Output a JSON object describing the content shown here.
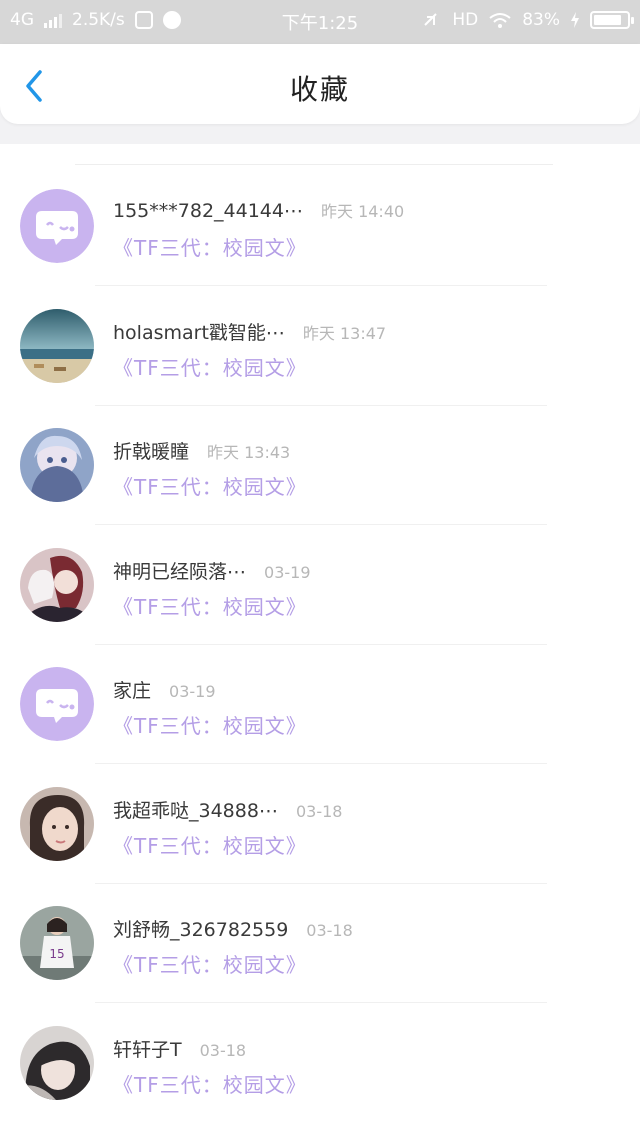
{
  "status_bar": {
    "network": "4G",
    "speed": "2.5K/s",
    "time": "下午1:25",
    "hd": "HD",
    "battery": "83%",
    "battery_level": 0.83
  },
  "header": {
    "title": "收藏"
  },
  "items": [
    {
      "name": "155***782_44144⋯",
      "time": "昨天 14:40",
      "novel": "《TF三代：校园文》",
      "avatar": "bubble"
    },
    {
      "name": "holasmart戳智能⋯",
      "time": "昨天 13:47",
      "novel": "《TF三代：校园文》",
      "avatar": "beach"
    },
    {
      "name": "折戟暖瞳",
      "time": "昨天 13:43",
      "novel": "《TF三代：校园文》",
      "avatar": "anime-blue"
    },
    {
      "name": "神明已经陨落⋯",
      "time": "03-19",
      "novel": "《TF三代：校园文》",
      "avatar": "anime-red"
    },
    {
      "name": "家庄",
      "time": "03-19",
      "novel": "《TF三代：校园文》",
      "avatar": "bubble"
    },
    {
      "name": "我超乖哒_34888⋯",
      "time": "03-18",
      "novel": "《TF三代：校园文》",
      "avatar": "photo-face"
    },
    {
      "name": "刘舒畅_326782559",
      "time": "03-18",
      "novel": "《TF三代：校园文》",
      "avatar": "photo-sport"
    },
    {
      "name": "轩轩子T",
      "time": "03-18",
      "novel": "《TF三代：校园文》",
      "avatar": "photo-hood"
    }
  ]
}
